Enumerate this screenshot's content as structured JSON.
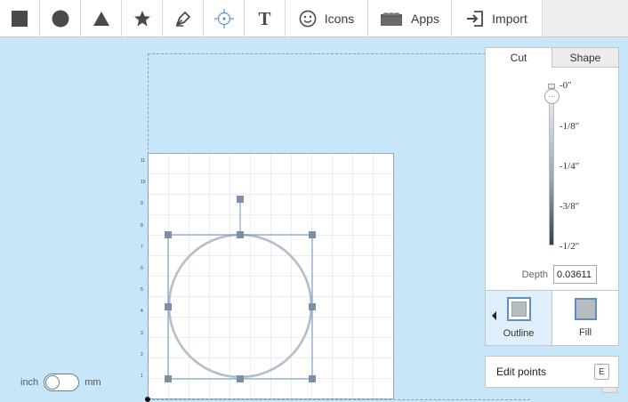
{
  "toolbar": {
    "tools": [
      {
        "id": "box",
        "icon": "square-icon"
      },
      {
        "id": "ellipse",
        "icon": "circle-icon"
      },
      {
        "id": "polygon",
        "icon": "triangle-icon"
      },
      {
        "id": "star",
        "icon": "star-icon"
      },
      {
        "id": "pen",
        "icon": "pen-icon"
      },
      {
        "id": "point",
        "icon": "crosshair-icon"
      },
      {
        "id": "text",
        "icon": "text-icon",
        "glyph": "T"
      }
    ],
    "icons_label": "Icons",
    "apps_label": "Apps",
    "import_label": "Import"
  },
  "ruler": [
    "11",
    "10",
    "9",
    "8",
    "7",
    "6",
    "5",
    "4",
    "3",
    "2",
    "1"
  ],
  "panel": {
    "tabs": [
      {
        "label": "Cut",
        "active": true
      },
      {
        "label": "Shape",
        "active": false
      }
    ],
    "slider": {
      "ticks": [
        "-0″",
        "-1/8″",
        "-1/4″",
        "-3/8″",
        "-1/2″"
      ],
      "knob_glyph": "···",
      "value_fraction": 0.0
    },
    "depth_label": "Depth",
    "depth_value": "0.03611",
    "modes": {
      "outline_label": "Outline",
      "fill_label": "Fill",
      "active": "outline"
    }
  },
  "edit_points": {
    "label": "Edit points",
    "shortcut": "E"
  },
  "units": {
    "left_label": "inch",
    "right_label": "mm",
    "selected": "inch"
  },
  "colors": {
    "canvas_bg": "#c8e6fa",
    "selection": "#6b8fb7",
    "handle": "#7b8fa6",
    "accent": "#5f90c4"
  }
}
